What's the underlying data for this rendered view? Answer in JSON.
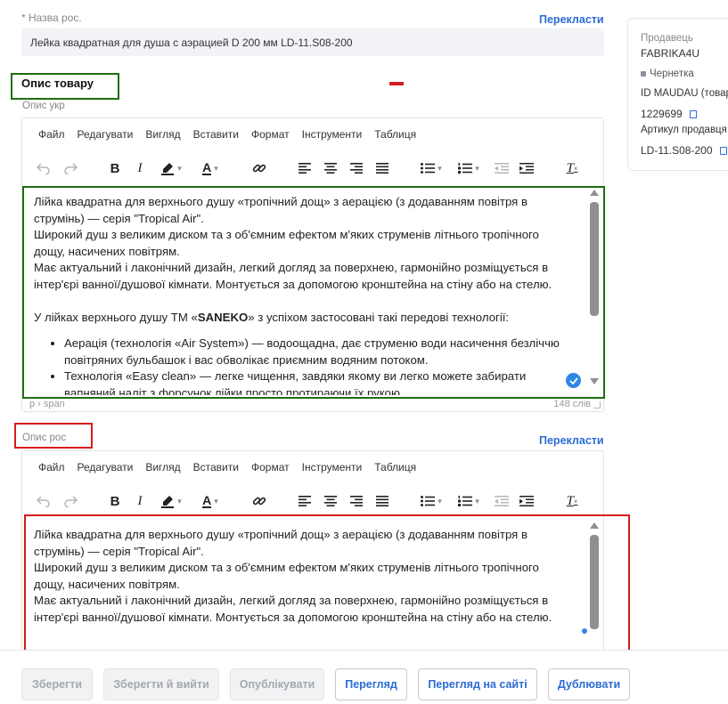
{
  "name_ru": {
    "label": "Назва рос.",
    "required_mark": "*",
    "translate_link": "Перекласти",
    "value": "Лейка квадратная для душа с аэрацией D 200 мм LD-11.S08-200"
  },
  "description_section": {
    "title": "Опис товару",
    "label_uk": "Опис укр"
  },
  "menu_items": [
    "Файл",
    "Редагувати",
    "Вигляд",
    "Вставити",
    "Формат",
    "Інструменти",
    "Таблиця"
  ],
  "editor_uk": {
    "paragraphs": [
      "Лійка квадратна для верхнього душу «тропічний дощ» з аерацією (з додаванням повітря в струмінь) — серія \"Tropical Air\".",
      "Широкий душ з великим диском та з об'ємним ефектом м'яких струменів літнього тропічного дощу, насичених повітрям.",
      "Має актуальний і лаконічний дизайн, легкий догляд за поверхнею, гармонійно розміщується в інтер'єрі ванної/душової кімнати. Монтується за допомогою кронштейна на стіну або на стелю."
    ],
    "tech_intro_before": "У лійках верхнього душу ТМ «",
    "tech_intro_brand": "SANEKO",
    "tech_intro_after": "» з успіхом застосовані такі передові технології:",
    "list_items": [
      "Аерація (технологія «Air System») — водоощадна, дає струменю води насичення безліччю повітряних бульбашок і вас обволікає приємним водяним потоком.",
      "Технологія «Easy clean» — легке чищення, завдяки якому ви легко можете забирати вапняний наліт з форсунок лійки просто протираючи їх рукою."
    ],
    "status_path": "p › span",
    "word_count": "148 слів"
  },
  "description_ru": {
    "label": "Опис рос",
    "translate_link": "Перекласти"
  },
  "editor_ru": {
    "paragraphs": [
      "Лійка квадратна для верхнього душу «тропічний дощ» з аерацією (з додаванням повітря в струмінь) — серія \"Tropical Air\".",
      "Широкий душ з великим диском та з об'ємним ефектом м'яких струменів літнього тропічного дощу, насичених повітрям.",
      "Має актуальний і лаконічний дизайн, легкий догляд за поверхнею, гармонійно розміщується в інтер'єрі ванної/душової кімнати. Монтується за допомогою кронштейна на стіну або на стелю."
    ]
  },
  "seller_card": {
    "seller_label": "Продавець",
    "seller_value": "FABRIKA4U",
    "status": "Чернетка",
    "id_label": "ID MAUDAU (товар)",
    "id_value": "1229699",
    "article_label": "Артикул продавця",
    "article_value": "LD-11.S08-200"
  },
  "buttons": {
    "save": "Зберегти",
    "save_exit": "Зберегти й вийти",
    "publish": "Опублікувати",
    "preview": "Перегляд",
    "preview_site": "Перегляд на сайті",
    "duplicate": "Дублювати"
  },
  "colors": {
    "highlight_green": "#1e6e0f",
    "highlight_red": "#d61c1c",
    "link_blue": "#2b6cd4",
    "check_badge": "#2f86e8"
  }
}
